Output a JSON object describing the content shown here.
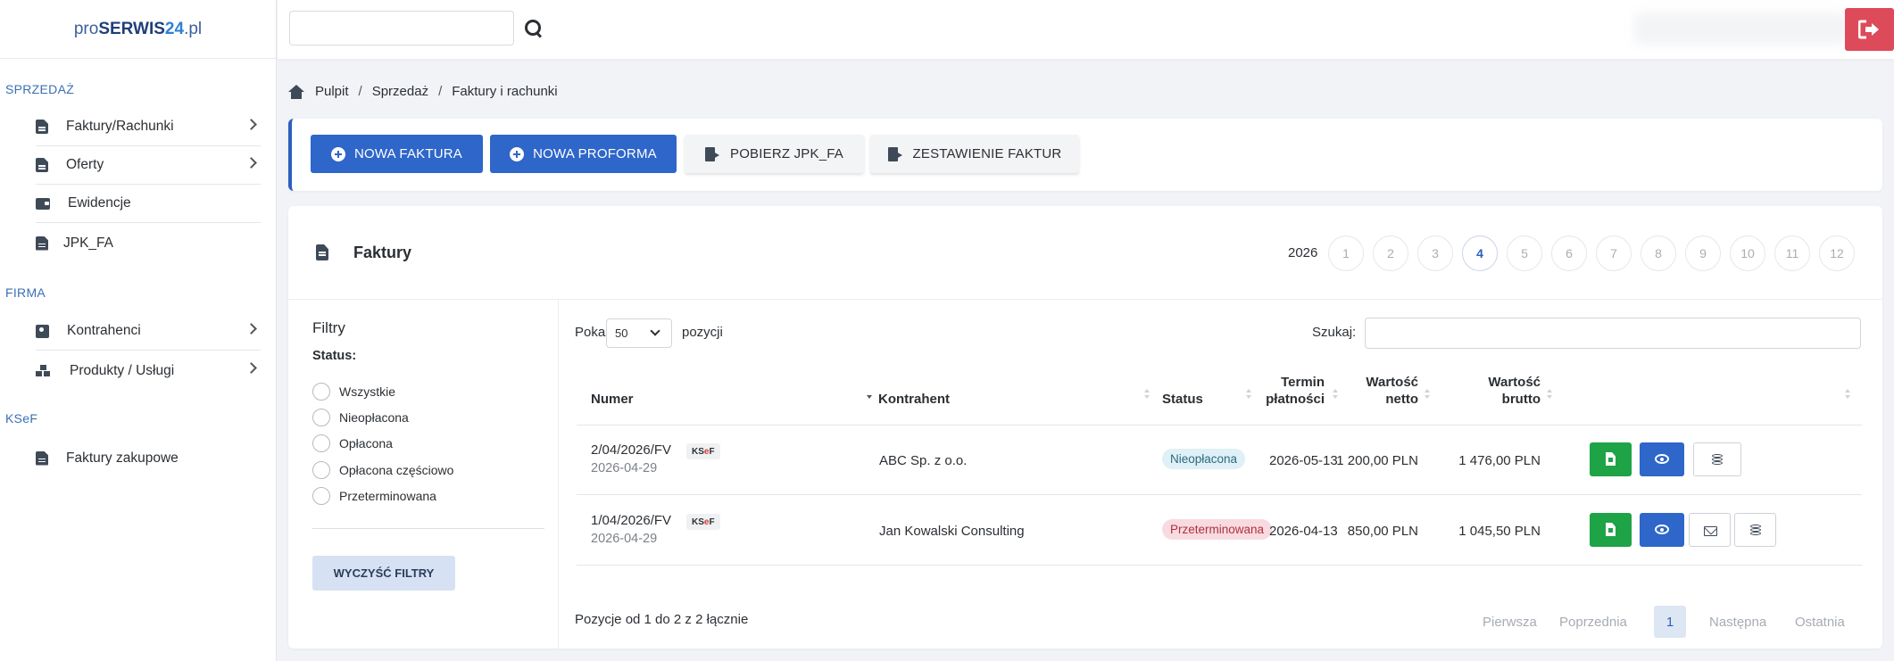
{
  "app": {
    "logo_pre": "pro",
    "logo_bold": "SERWIS",
    "logo_num": "24",
    "logo_post": ".pl"
  },
  "sidebar": {
    "sections": [
      "SPRZEDAŻ",
      "FIRMA",
      "KSeF"
    ],
    "items": [
      {
        "label": "Faktury/Rachunki",
        "icon": "invoice-icon"
      },
      {
        "label": "Oferty",
        "icon": "document-icon"
      },
      {
        "label": "Ewidencje",
        "icon": "wallet-icon"
      },
      {
        "label": "JPK_FA",
        "icon": "document-icon"
      },
      {
        "label": "Kontrahenci",
        "icon": "contact-card-icon"
      },
      {
        "label": "Produkty / Usługi",
        "icon": "boxes-icon"
      },
      {
        "label": "Faktury zakupowe",
        "icon": "invoice-icon"
      }
    ]
  },
  "topbar": {
    "search_value": "",
    "logout_icon": "sign-out-icon",
    "logout_color": "#dd4a5a"
  },
  "breadcrumb": [
    "Pulpit",
    "Sprzedaż",
    "Faktury i rachunki"
  ],
  "actions": {
    "new_invoice": "NOWA FAKTURA",
    "new_proforma": "NOWA PROFORMA",
    "download_jpk": "POBIERZ JPK_FA",
    "invoice_summary": "ZESTAWIENIE FAKTUR"
  },
  "card": {
    "title": "Faktury",
    "year": "2026",
    "months": [
      "1",
      "2",
      "3",
      "4",
      "5",
      "6",
      "7",
      "8",
      "9",
      "10",
      "11",
      "12"
    ],
    "active_month": "4"
  },
  "filters": {
    "title": "Filtry",
    "status_label": "Status:",
    "options": [
      "Wszystkie",
      "Nieopłacona",
      "Opłacona",
      "Opłacona częściowo",
      "Przeterminowana"
    ],
    "clear": "WYCZYŚĆ FILTRY"
  },
  "table": {
    "show_label": "Pokaż",
    "page_size": "50",
    "positions_label": "pozycji",
    "search_label": "Szukaj:",
    "search_value": "",
    "headers": {
      "number": "Numer",
      "contractor": "Kontrahent",
      "status": "Status",
      "due_1": "Termin",
      "due_2": "płatności",
      "net_1": "Wartość",
      "net_2": "netto",
      "gross_1": "Wartość",
      "gross_2": "brutto"
    },
    "rows": [
      {
        "number": "2/04/2026/FV",
        "date": "2026-04-29",
        "badge_k": "KS",
        "badge_e": "e",
        "badge_f": "F",
        "contractor": "ABC Sp. z o.o.",
        "status": "Nieopłacona",
        "due": "2026-05-13",
        "net": "1 200,00 PLN",
        "gross": "1 476,00 PLN"
      },
      {
        "number": "1/04/2026/FV",
        "date": "2026-04-29",
        "badge_k": "KS",
        "badge_e": "e",
        "badge_f": "F",
        "contractor": "Jan Kowalski Consulting",
        "status": "Przeterminowana",
        "due": "2026-04-13",
        "net": "850,00 PLN",
        "gross": "1 045,50 PLN"
      }
    ],
    "info": "Pozycje od 1 do 2 z 2 łącznie",
    "pagination": {
      "first": "Pierwsza",
      "prev": "Poprzednia",
      "current": "1",
      "next": "Następna",
      "last": "Ostatnia"
    }
  },
  "colors": {
    "primary": "#2e66c9",
    "success": "#1ea346",
    "danger": "#dd4a5a"
  }
}
